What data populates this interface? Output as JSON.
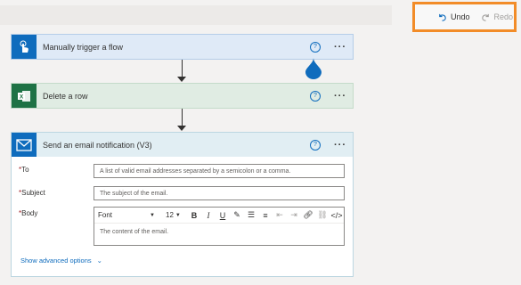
{
  "toolbar": {
    "undo_label": "Undo",
    "redo_label": "Redo",
    "undo_icon": "undo-icon",
    "redo_icon": "redo-icon"
  },
  "steps": [
    {
      "title": "Manually trigger a flow",
      "icon": "touch-icon",
      "color": "#0f6cbd"
    },
    {
      "title": "Delete a row",
      "icon": "excel-icon",
      "color": "#1e7245"
    },
    {
      "title": "Send an email notification (V3)",
      "icon": "mail-icon",
      "color": "#0f6cbd"
    }
  ],
  "help_glyph": "?",
  "more_glyph": "···",
  "email_form": {
    "to_label": "To",
    "to_placeholder": "A list of valid email addresses separated by a semicolon or a comma.",
    "subject_label": "Subject",
    "subject_placeholder": "The subject of the email.",
    "body_label": "Body",
    "required_mark": "*",
    "font_value": "Font",
    "size_value": "12",
    "toolbar_buttons": [
      "B",
      "I",
      "U"
    ],
    "body_placeholder": "The content of the email.",
    "advanced_options": "Show advanced options"
  }
}
